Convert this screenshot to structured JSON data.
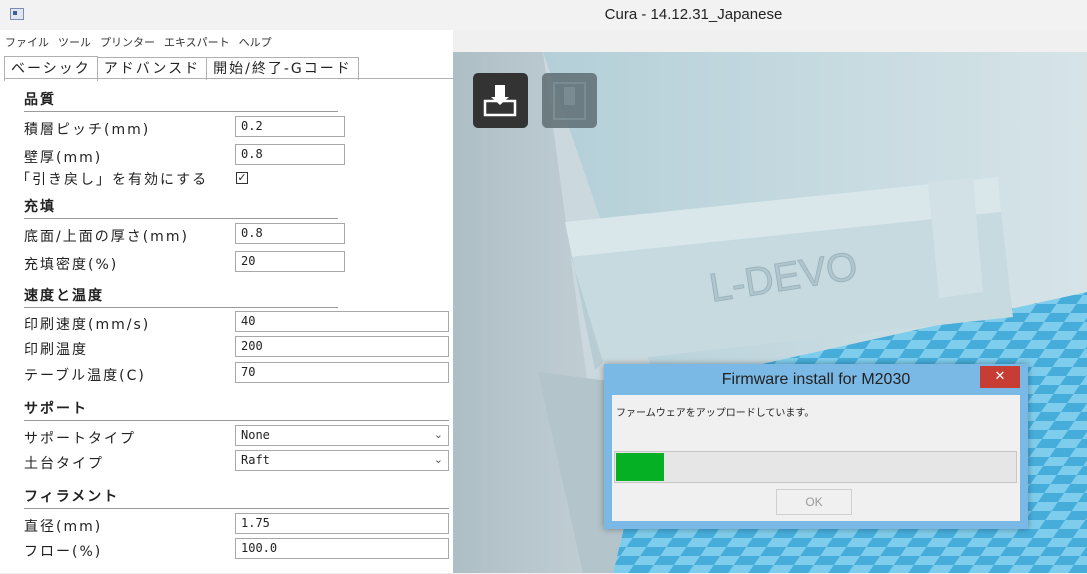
{
  "window": {
    "title": "Cura - 14.12.31_Japanese"
  },
  "menu": [
    "ファイル",
    "ツール",
    "プリンター",
    "エキスパート",
    "ヘルプ"
  ],
  "tabs": [
    "ベーシック",
    "アドバンスド",
    "開始/終了-Gコード"
  ],
  "settings": {
    "quality": {
      "header": "品質",
      "layer_height": {
        "label": "積層ピッチ(mm)",
        "value": "0.2"
      },
      "shell_thickness": {
        "label": "壁厚(mm)",
        "value": "0.8"
      },
      "retraction": {
        "label": "「引き戻し」を有効にする",
        "checked": true,
        "mark": "✓"
      }
    },
    "fill": {
      "header": "充填",
      "bottom_top": {
        "label": "底面/上面の厚さ(mm)",
        "value": "0.8"
      },
      "density": {
        "label": "充填密度(%)",
        "value": "20"
      }
    },
    "speed": {
      "header": "速度と温度",
      "print_speed": {
        "label": "印刷速度(mm/s)",
        "value": "40"
      },
      "print_temp": {
        "label": "印刷温度",
        "value": "200"
      },
      "bed_temp": {
        "label": "テーブル温度(C)",
        "value": "70"
      }
    },
    "support": {
      "header": "サポート",
      "support_type": {
        "label": "サポートタイプ",
        "value": "None"
      },
      "platform": {
        "label": "土台タイプ",
        "value": "Raft"
      }
    },
    "filament": {
      "header": "フィラメント",
      "diameter": {
        "label": "直径(mm)",
        "value": "1.75"
      },
      "flow": {
        "label": "フロー(%)",
        "value": "100.0"
      }
    }
  },
  "model_text": "L-DEVO",
  "dialog": {
    "title": "Firmware install for M2030",
    "close": "✕",
    "message": "ファームウェアをアップロードしています。",
    "progress": 0.12,
    "ok": "OK"
  },
  "icons": {
    "load": "load-model-icon",
    "sd": "sd-card-icon",
    "dropdown": "chevron-down-icon"
  },
  "colors": {
    "accent": "#7ab8e6",
    "progress": "#06b025",
    "close": "#c73c33",
    "viewport": "#b9c8cf",
    "grid": "#4fb3dc"
  }
}
